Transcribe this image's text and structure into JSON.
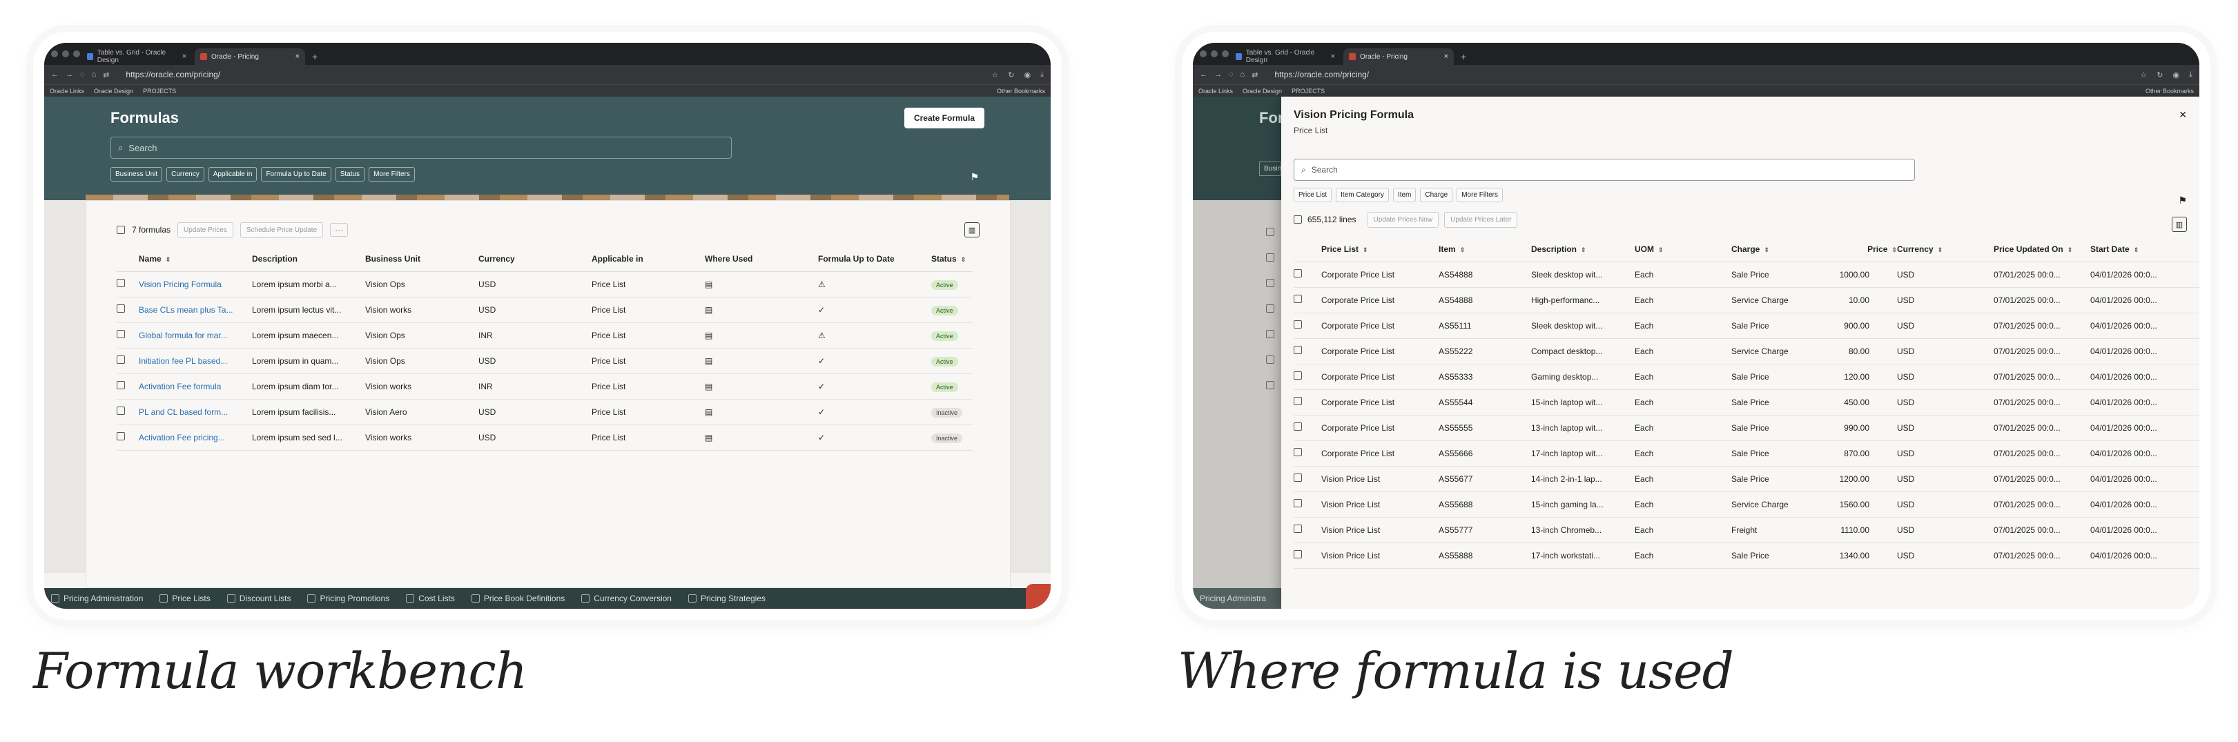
{
  "left": {
    "browser": {
      "tabs": [
        "Table vs. Grid - Oracle Design",
        "Oracle - Pricing"
      ],
      "url": "https://oracle.com/pricing/",
      "bookmarks": [
        "Oracle Links",
        "Oracle Design",
        "PROJECTS"
      ],
      "other_bookmarks": "Other Bookmarks"
    },
    "title": "Formulas",
    "create_button": "Create Formula",
    "search_placeholder": "Search",
    "filters": [
      "Business Unit",
      "Currency",
      "Applicable in",
      "Formula Up to Date",
      "Status",
      "More Filters"
    ],
    "count": "7 formulas",
    "toolbar_buttons": [
      "Update Prices",
      "Schedule Price Update"
    ],
    "more_label": "···",
    "columns": [
      "Name",
      "Description",
      "Business Unit",
      "Currency",
      "Applicable in",
      "Where Used",
      "Formula Up to Date",
      "Status"
    ],
    "rows": [
      {
        "name": "Vision Pricing Formula",
        "desc": "Lorem ipsum morbi a...",
        "bu": "Vision Ops",
        "cur": "USD",
        "app": "Price List",
        "up": "warning",
        "status": "Active"
      },
      {
        "name": "Base CLs mean plus Ta...",
        "desc": "Lorem ipsum lectus vit...",
        "bu": "Vision works",
        "cur": "USD",
        "app": "Price List",
        "up": "check",
        "status": "Active"
      },
      {
        "name": "Global formula for mar...",
        "desc": "Lorem ipsum maecen...",
        "bu": "Vision Ops",
        "cur": "INR",
        "app": "Price List",
        "up": "warning",
        "status": "Active"
      },
      {
        "name": "Initiation fee PL based...",
        "desc": "Lorem ipsum in quam...",
        "bu": "Vision Ops",
        "cur": "USD",
        "app": "Price List",
        "up": "check",
        "status": "Active"
      },
      {
        "name": "Activation Fee formula",
        "desc": "Lorem ipsum diam tor...",
        "bu": "Vision works",
        "cur": "INR",
        "app": "Price List",
        "up": "check",
        "status": "Active"
      },
      {
        "name": "PL and CL based form...",
        "desc": "Lorem ipsum facilisis...",
        "bu": "Vision Aero",
        "cur": "USD",
        "app": "Price List",
        "up": "check",
        "status": "Inactive"
      },
      {
        "name": "Activation Fee pricing...",
        "desc": "Lorem ipsum sed sed l...",
        "bu": "Vision works",
        "cur": "USD",
        "app": "Price List",
        "up": "check",
        "status": "Inactive"
      }
    ],
    "bottom_nav": [
      "Pricing Administration",
      "Price Lists",
      "Discount Lists",
      "Pricing Promotions",
      "Cost Lists",
      "Price Book Definitions",
      "Currency Conversion",
      "Pricing Strategies"
    ],
    "caption": "Formula workbench"
  },
  "right": {
    "browser": {
      "tabs": [
        "Table vs. Grid - Oracle Design",
        "Oracle - Pricing"
      ],
      "url": "https://oracle.com/pricing/",
      "bookmarks": [
        "Oracle Links",
        "Oracle Design",
        "PROJECTS"
      ],
      "other_bookmarks": "Other Bookmarks"
    },
    "drawer_title": "Vision Pricing Formula",
    "drawer_subtitle": "Price List",
    "search_placeholder": "Search",
    "filters": [
      "Price List",
      "Item Category",
      "Item",
      "Charge",
      "More Filters"
    ],
    "count": "655,112 lines",
    "toolbar_buttons": [
      "Update Prices Now",
      "Update Prices Later"
    ],
    "columns": [
      "Price List",
      "Item",
      "Description",
      "UOM",
      "Charge",
      "Price",
      "Currency",
      "Price Updated On",
      "Start Date"
    ],
    "rows": [
      [
        "Corporate Price List",
        "AS54888",
        "Sleek desktop wit...",
        "Each",
        "Sale Price",
        "1000.00",
        "USD",
        "07/01/2025 00:0...",
        "04/01/2026 00:0..."
      ],
      [
        "Corporate Price List",
        "AS54888",
        "High-performanc...",
        "Each",
        "Service Charge",
        "10.00",
        "USD",
        "07/01/2025 00:0...",
        "04/01/2026 00:0..."
      ],
      [
        "Corporate Price List",
        "AS55111",
        "Sleek desktop wit...",
        "Each",
        "Sale Price",
        "900.00",
        "USD",
        "07/01/2025 00:0...",
        "04/01/2026 00:0..."
      ],
      [
        "Corporate Price List",
        "AS55222",
        "Compact desktop...",
        "Each",
        "Service Charge",
        "80.00",
        "USD",
        "07/01/2025 00:0...",
        "04/01/2026 00:0..."
      ],
      [
        "Corporate Price List",
        "AS55333",
        "Gaming desktop...",
        "Each",
        "Sale Price",
        "120.00",
        "USD",
        "07/01/2025 00:0...",
        "04/01/2026 00:0..."
      ],
      [
        "Corporate Price List",
        "AS55544",
        "15-inch laptop wit...",
        "Each",
        "Sale Price",
        "450.00",
        "USD",
        "07/01/2025 00:0...",
        "04/01/2026 00:0..."
      ],
      [
        "Corporate Price List",
        "AS55555",
        "13-inch laptop wit...",
        "Each",
        "Sale Price",
        "990.00",
        "USD",
        "07/01/2025 00:0...",
        "04/01/2026 00:0..."
      ],
      [
        "Corporate Price List",
        "AS55666",
        "17-inch laptop wit...",
        "Each",
        "Sale Price",
        "870.00",
        "USD",
        "07/01/2025 00:0...",
        "04/01/2026 00:0..."
      ],
      [
        "Vision Price List",
        "AS55677",
        "14-inch 2-in-1 lap...",
        "Each",
        "Sale Price",
        "1200.00",
        "USD",
        "07/01/2025 00:0...",
        "04/01/2026 00:0..."
      ],
      [
        "Vision Price List",
        "AS55688",
        "15-inch gaming la...",
        "Each",
        "Service Charge",
        "1560.00",
        "USD",
        "07/01/2025 00:0...",
        "04/01/2026 00:0..."
      ],
      [
        "Vision Price List",
        "AS55777",
        "13-inch Chromeb...",
        "Each",
        "Freight",
        "1110.00",
        "USD",
        "07/01/2025 00:0...",
        "04/01/2026 00:0..."
      ],
      [
        "Vision Price List",
        "AS55888",
        "17-inch workstati...",
        "Each",
        "Sale Price",
        "1340.00",
        "USD",
        "07/01/2025 00:0...",
        "04/01/2026 00:0..."
      ]
    ],
    "bottom_nav_first": "Pricing Administra",
    "behind_title": "For",
    "behind_chip": "Busin",
    "caption": "Where formula is used"
  }
}
